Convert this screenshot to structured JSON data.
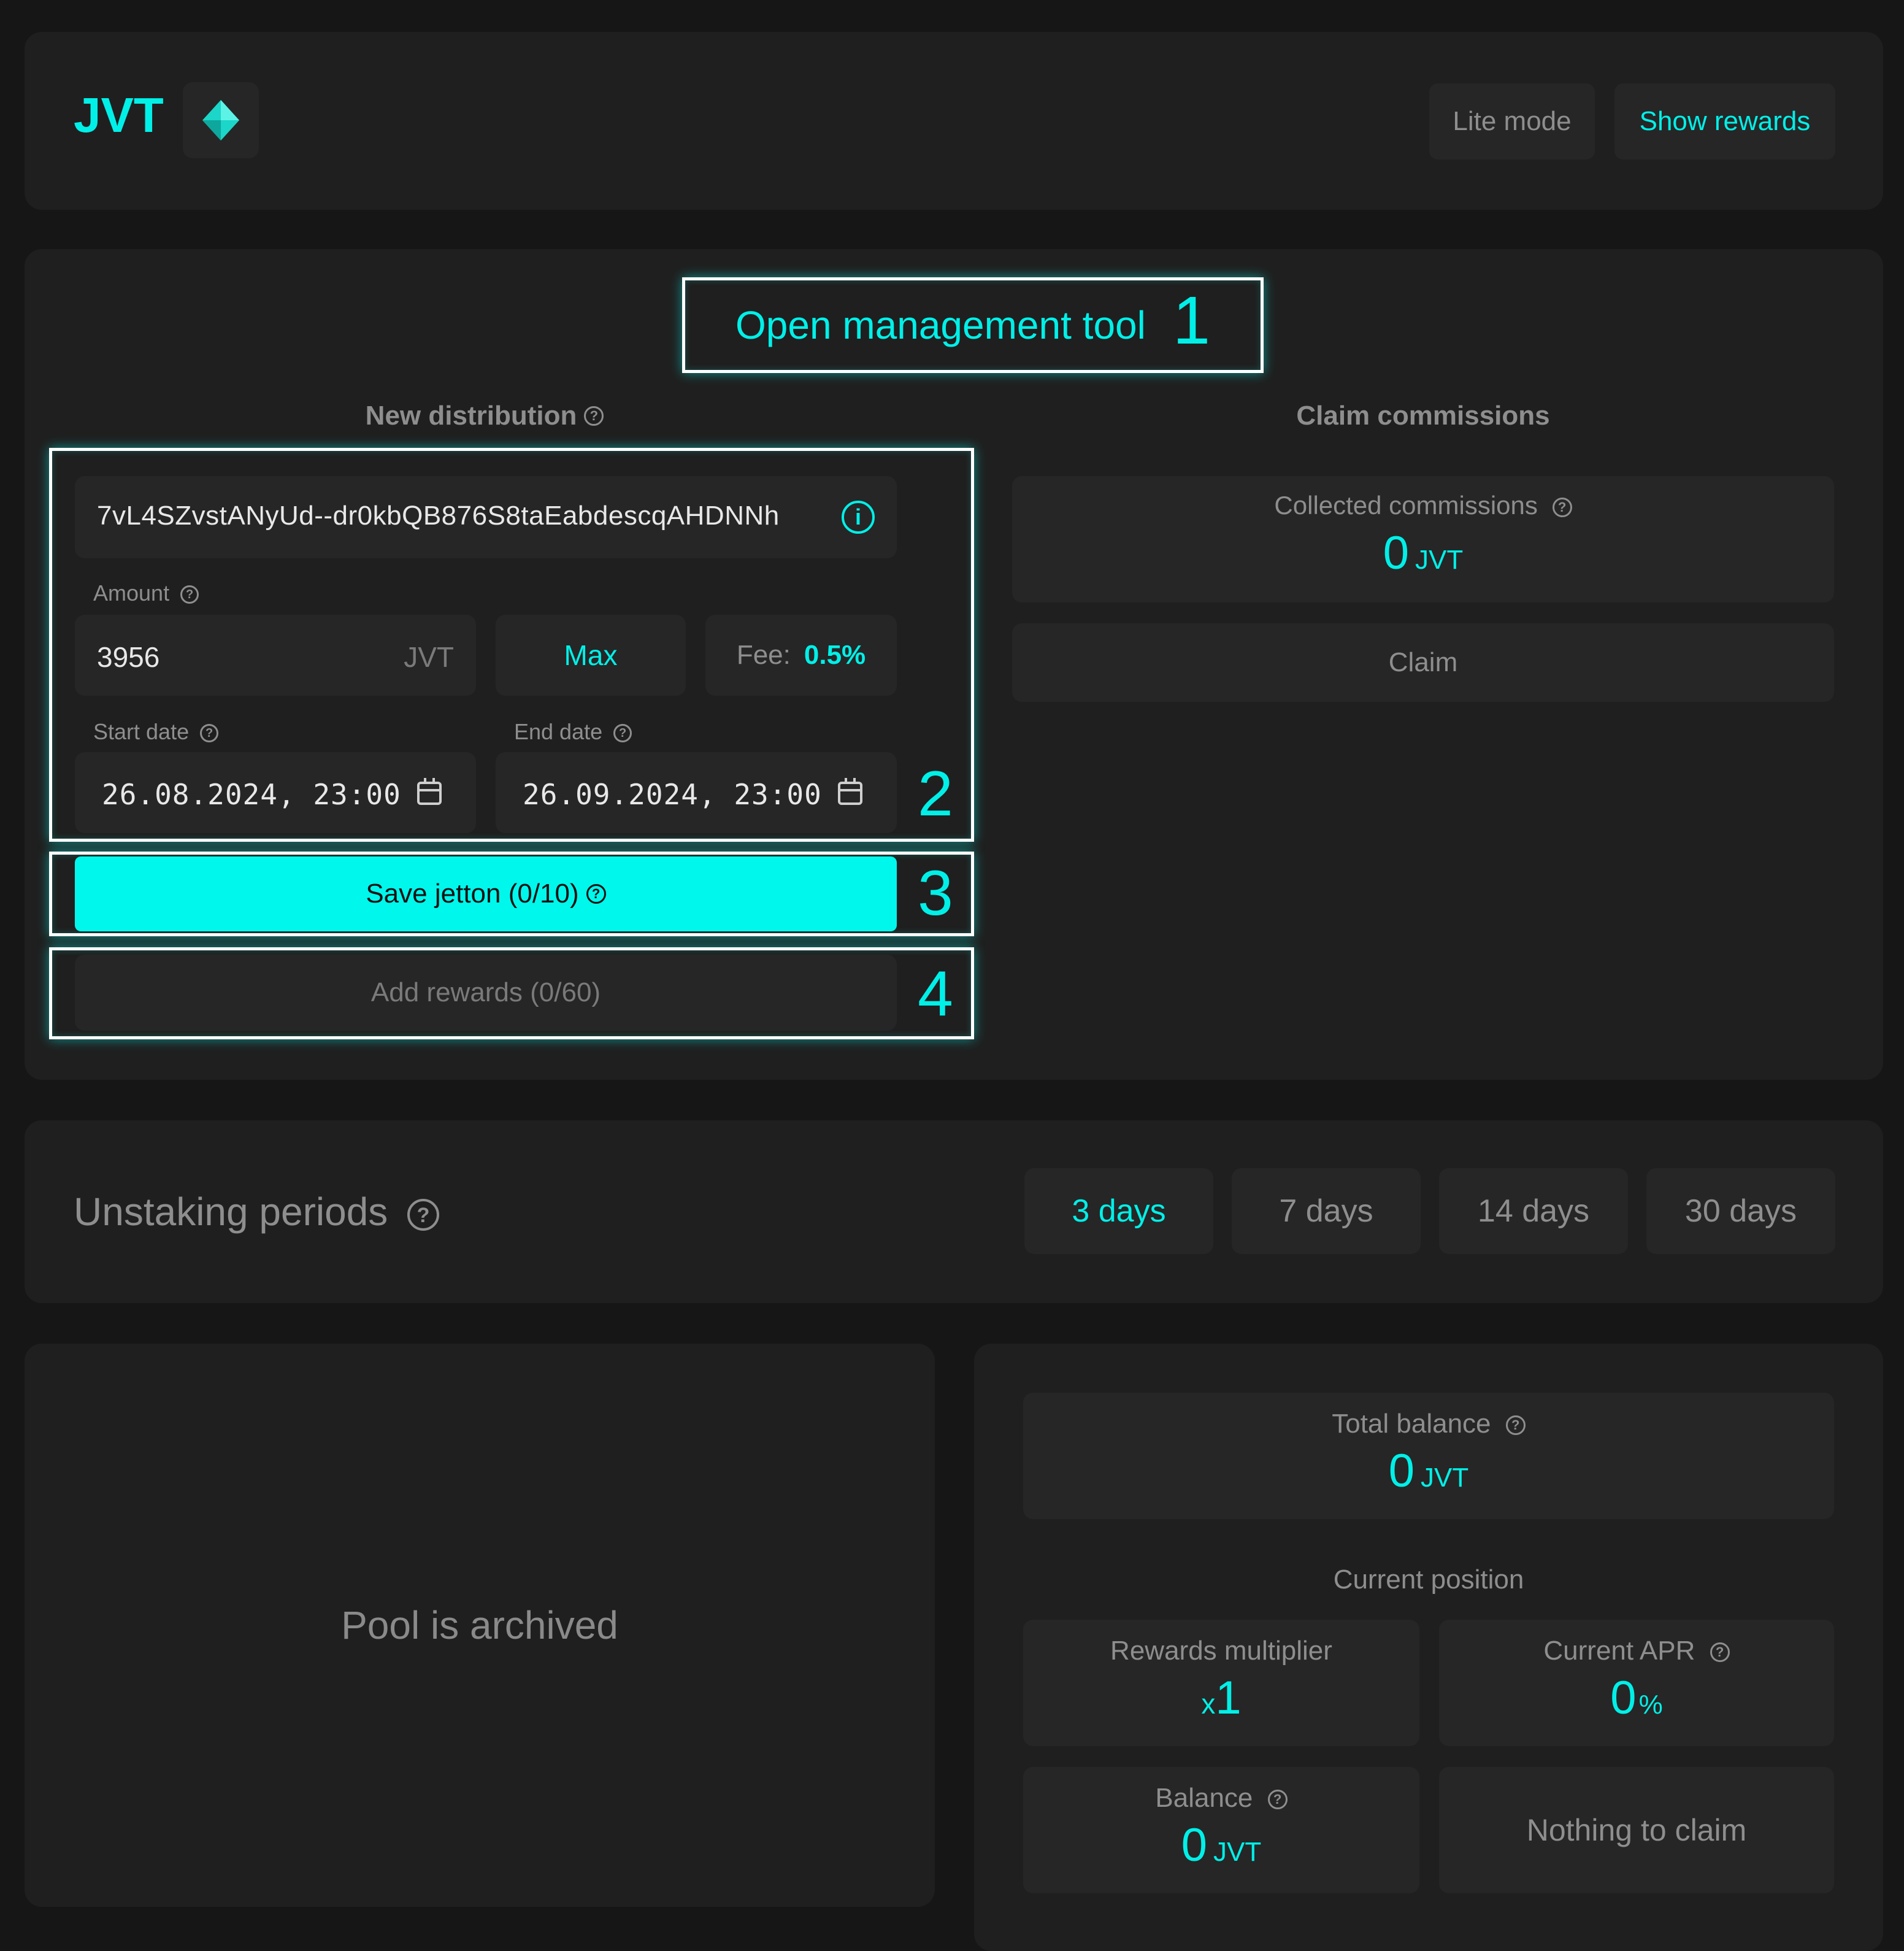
{
  "header": {
    "token": "JVT",
    "lite_mode": "Lite mode",
    "show_rewards": "Show rewards"
  },
  "management": {
    "open_tool": "Open management tool",
    "markers": [
      "1",
      "2",
      "3",
      "4"
    ]
  },
  "distribution": {
    "title": "New distribution",
    "address": "7vL4SZvstANyUd--dr0kbQB876S8taEabdescqAHDNNh",
    "amount_label": "Amount",
    "amount_value": "3956",
    "amount_unit": "JVT",
    "max_label": "Max",
    "fee_label": "Fee:",
    "fee_value": "0.5%",
    "start_label": "Start date",
    "start_value": "26.08.2024, 23:00",
    "end_label": "End date",
    "end_value": "26.09.2024, 23:00",
    "save_label": "Save jetton (0/10)",
    "add_rewards_label": "Add rewards (0/60)"
  },
  "commissions": {
    "title": "Claim commissions",
    "collected_label": "Collected commissions",
    "collected_value": "0",
    "collected_unit": "JVT",
    "claim_label": "Claim"
  },
  "unstaking": {
    "title": "Unstaking periods",
    "periods": [
      "3 days",
      "7 days",
      "14 days",
      "30 days"
    ],
    "selected": "3 days"
  },
  "pool": {
    "status": "Pool is archived"
  },
  "position": {
    "total_balance_label": "Total balance",
    "total_balance_value": "0",
    "total_balance_unit": "JVT",
    "current_position_label": "Current position",
    "multiplier_label": "Rewards multiplier",
    "multiplier_prefix": "x",
    "multiplier_value": "1",
    "apr_label": "Current APR",
    "apr_value": "0",
    "apr_unit": "%",
    "balance_label": "Balance",
    "balance_value": "0",
    "balance_unit": "JVT",
    "nothing_to_claim": "Nothing to claim"
  },
  "colors": {
    "accent": "#00f0e8",
    "background": "#161616",
    "card": "#1f1f1f",
    "tile": "#262626"
  }
}
